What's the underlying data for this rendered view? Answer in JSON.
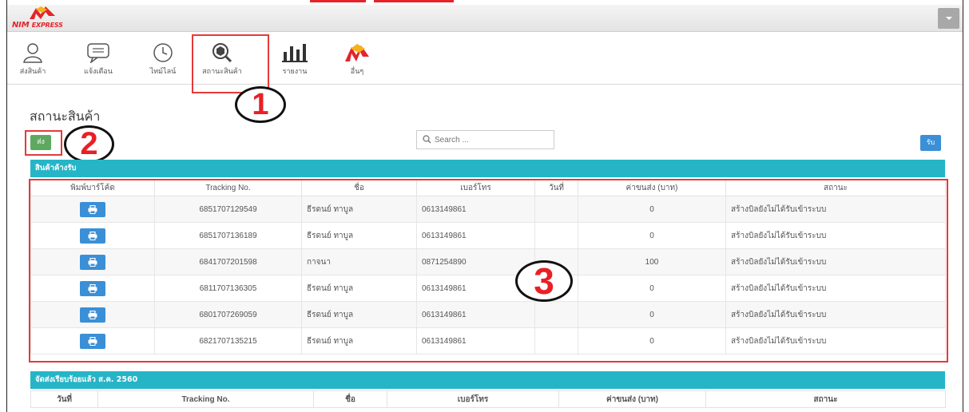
{
  "header": {
    "logo_text": "NIM",
    "logo_sub": "EXPRESS"
  },
  "toolbar": {
    "items": [
      {
        "label": "ส่งสินค้า",
        "icon": "user-icon"
      },
      {
        "label": "แจ้งเตือน",
        "icon": "message-icon"
      },
      {
        "label": "ไทม์ไลน์",
        "icon": "clock-icon"
      },
      {
        "label": "สถานะสินค้า",
        "icon": "search-box-icon"
      },
      {
        "label": "รายงาน",
        "icon": "bar-chart-icon"
      },
      {
        "label": "อื่นๆ",
        "icon": "nim-logo-icon"
      }
    ]
  },
  "annotations": [
    "1",
    "2",
    "3"
  ],
  "page": {
    "title": "สถานะสินค้า",
    "send_button": "ส่ง",
    "receive_button": "รับ",
    "search_placeholder": "Search ..."
  },
  "pending_table": {
    "title": "สินค้าค้างรับ",
    "columns": [
      "พิมพ์บาร์โค้ด",
      "Tracking No.",
      "ชื่อ",
      "เบอร์โทร",
      "วันที่",
      "ค่าขนส่ง (บาท)",
      "สถานะ"
    ],
    "rows": [
      {
        "tracking": "6851707129549",
        "name": "ธีรดนย์ ทาบูล",
        "phone": "0613149861",
        "date": "",
        "fee": "0",
        "status": "สร้างบิลยังไม่ได้รับเข้าระบบ"
      },
      {
        "tracking": "6851707136189",
        "name": "ธีรดนย์ ทาบูล",
        "phone": "0613149861",
        "date": "",
        "fee": "0",
        "status": "สร้างบิลยังไม่ได้รับเข้าระบบ"
      },
      {
        "tracking": "6841707201598",
        "name": "กาจนา",
        "phone": "0871254890",
        "date": "",
        "fee": "100",
        "status": "สร้างบิลยังไม่ได้รับเข้าระบบ"
      },
      {
        "tracking": "6811707136305",
        "name": "ธีรดนย์ ทาบูล",
        "phone": "0613149861",
        "date": "",
        "fee": "0",
        "status": "สร้างบิลยังไม่ได้รับเข้าระบบ"
      },
      {
        "tracking": "6801707269059",
        "name": "ธีรดนย์ ทาบูล",
        "phone": "0613149861",
        "date": "",
        "fee": "0",
        "status": "สร้างบิลยังไม่ได้รับเข้าระบบ"
      },
      {
        "tracking": "6821707135215",
        "name": "ธีรดนย์ ทาบูล",
        "phone": "0613149861",
        "date": "",
        "fee": "0",
        "status": "สร้างบิลยังไม่ได้รับเข้าระบบ"
      }
    ]
  },
  "delivered_table": {
    "title": "จัดส่งเรียบร้อยแล้ว ส.ค. 2560",
    "columns": [
      "วันที่",
      "Tracking No.",
      "ชื่อ",
      "เบอร์โทร",
      "ค่าขนส่ง (บาท)",
      "สถานะ"
    ]
  },
  "colors": {
    "accent": "#25b5c7",
    "brand_red": "#e3242b",
    "send_green": "#5fa85f",
    "primary_blue": "#3a8fd6",
    "annotation_red": "#e53a3a"
  }
}
